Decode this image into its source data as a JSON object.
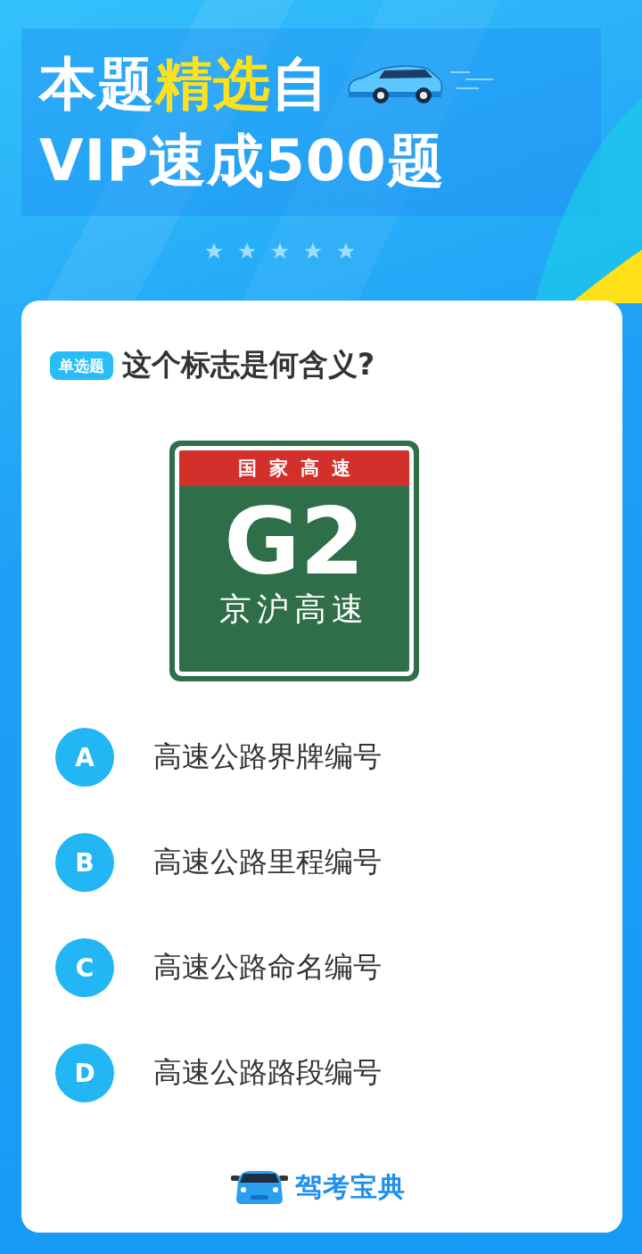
{
  "header": {
    "title_line1": [
      {
        "text": "本题",
        "highlight": false
      },
      {
        "text": "精选",
        "highlight": true
      },
      {
        "text": "自",
        "highlight": false
      }
    ],
    "title_line2": "VIP速成500题"
  },
  "question": {
    "badge": "单选题",
    "text": "这个标志是何含义?",
    "sign": {
      "top": "国家高速",
      "code": "G2",
      "name": "京沪高速"
    },
    "options": [
      {
        "letter": "A",
        "text": "高速公路界牌编号"
      },
      {
        "letter": "B",
        "text": "高速公路里程编号"
      },
      {
        "letter": "C",
        "text": "高速公路命名编号"
      },
      {
        "letter": "D",
        "text": "高速公路路段编号"
      }
    ]
  },
  "footer": {
    "brand": "驾考宝典"
  }
}
